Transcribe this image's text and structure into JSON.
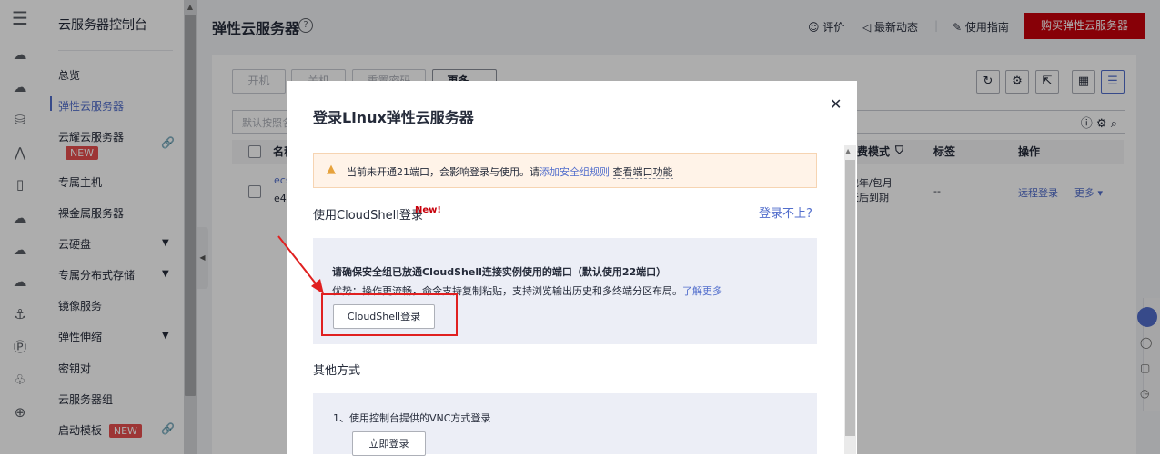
{
  "sidebar": {
    "title": "云服务器控制台",
    "items": [
      {
        "label": "总览"
      },
      {
        "label": "弹性云服务器"
      },
      {
        "label": "云耀云服务器"
      },
      {
        "label": "专属主机"
      },
      {
        "label": "裸金属服务器"
      },
      {
        "label": "云硬盘"
      },
      {
        "label": "专属分布式存储"
      },
      {
        "label": "镜像服务"
      },
      {
        "label": "弹性伸缩"
      },
      {
        "label": "密钥对"
      },
      {
        "label": "云服务器组"
      },
      {
        "label": "启动模板"
      }
    ],
    "new_badge": "NEW"
  },
  "header": {
    "title": "弹性云服务器",
    "rate": "评价",
    "news": "最新动态",
    "guide": "使用指南",
    "buy": "购买弹性云服务器"
  },
  "toolbar": {
    "start": "开机",
    "stop": "关机",
    "reset_pwd": "重置密码",
    "more": "更多 ⌄",
    "search_placeholder": "默认按照名"
  },
  "table": {
    "col_name": "名称",
    "col_billing": "计费模式",
    "col_tags": "标签",
    "col_ops": "操作",
    "row": {
      "name": "ecs",
      "id": "e4",
      "billing_line1": "包年/包月",
      "billing_line2": "天后到期",
      "tags": "--",
      "remote": "远程登录",
      "more": "更多"
    }
  },
  "modal": {
    "title": "登录Linux弹性云服务器",
    "warn_text": "当前未开通21端口，会影响登录与使用。请",
    "warn_link": "添加安全组规则",
    "warn_check": "查看端口功能",
    "cloudshell_heading": "使用CloudShell登录",
    "cloudshell_new": "New!",
    "cannot_login": "登录不上?",
    "cs_bold": "请确保安全组已放通CloudShell连接实例使用的端口（默认使用22端口）",
    "cs_desc": "优势：操作更流畅，命令支持复制粘贴，支持浏览输出历史和多终端分区布局。",
    "cs_learn": "了解更多",
    "cs_button": "CloudShell登录",
    "other_heading": "其他方式",
    "vnc_text": "1、使用控制台提供的VNC方式登录",
    "vnc_button": "立即登录"
  },
  "colors": {
    "accent": "#526ecc",
    "brand": "#c7000b",
    "highlight": "#e02020"
  }
}
